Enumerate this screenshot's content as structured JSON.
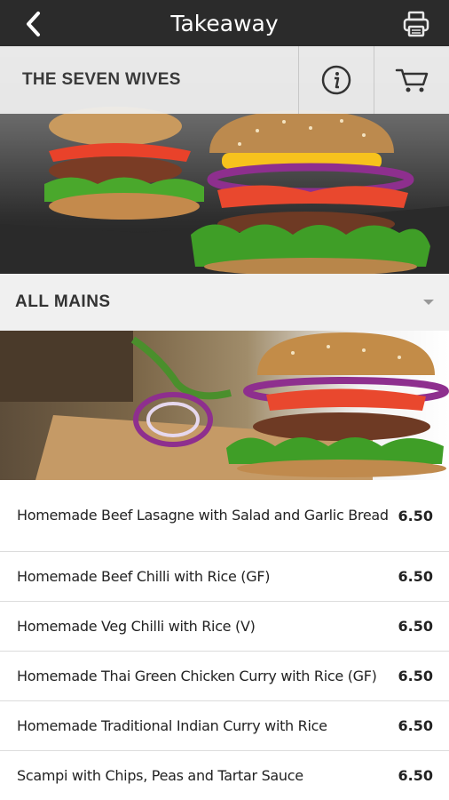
{
  "app": {
    "title": "Takeaway"
  },
  "restaurant": {
    "name": "THE SEVEN WIVES"
  },
  "category": {
    "selected": "ALL MAINS"
  },
  "menu": {
    "items": [
      {
        "name": "Homemade Beef Lasagne with Salad and Garlic Bread",
        "price": "6.50"
      },
      {
        "name": "Homemade Beef Chilli with Rice (GF)",
        "price": "6.50"
      },
      {
        "name": "Homemade Veg Chilli with Rice (V)",
        "price": "6.50"
      },
      {
        "name": "Homemade Thai Green Chicken Curry with Rice (GF)",
        "price": "6.50"
      },
      {
        "name": "Homemade Traditional Indian Curry with Rice",
        "price": "6.50"
      },
      {
        "name": "Scampi with Chips, Peas and Tartar Sauce",
        "price": "6.50"
      }
    ]
  },
  "icons": {
    "back": "chevron-left-icon",
    "print": "printer-icon",
    "info": "info-icon",
    "cart": "cart-icon",
    "dropdown": "caret-down-icon"
  },
  "colors": {
    "topbar": "#2b2b2b",
    "restaurant_bar": "#f0f0f0",
    "category_bar": "#f0f0f0"
  }
}
